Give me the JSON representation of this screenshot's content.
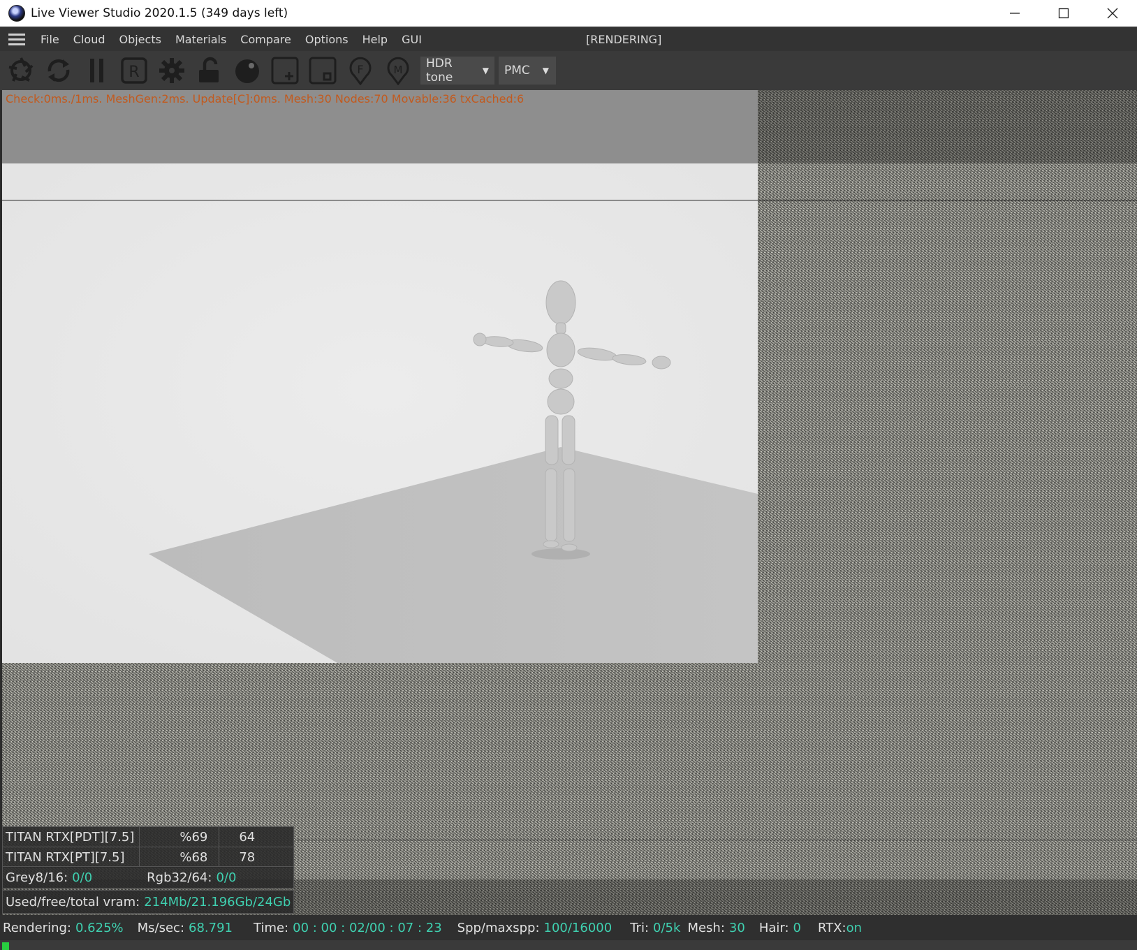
{
  "window": {
    "title": "Live Viewer Studio 2020.1.5 (349 days left)"
  },
  "menu": {
    "items": [
      "File",
      "Cloud",
      "Objects",
      "Materials",
      "Compare",
      "Options",
      "Help",
      "GUI"
    ],
    "status": "[RENDERING]"
  },
  "toolbar": {
    "buttons": [
      "aperture-icon",
      "refresh-icon",
      "pause-icon",
      "r-button-icon",
      "gear-icon",
      "unlock-icon",
      "sphere-icon",
      "add-region-icon",
      "region-icon",
      "f-pin-icon",
      "m-pin-icon"
    ],
    "r_label": "R",
    "f_label": "F",
    "m_label": "M",
    "tone_dropdown": "HDR tone",
    "kernel_dropdown": "PMC"
  },
  "viewport": {
    "info": "Check:0ms./1ms. MeshGen:2ms. Update[C]:0ms. Mesh:30 Nodes:70 Movable:36 txCached:6"
  },
  "gpus": [
    {
      "name": "TITAN RTX[PDT][7.5]",
      "pct": "%69",
      "value": "64"
    },
    {
      "name": "TITAN RTX[PT][7.5]",
      "pct": "%68",
      "value": "78"
    }
  ],
  "textures": {
    "grey_label": "Grey8/16:",
    "grey_value": "0/0",
    "rgb_label": "Rgb32/64:",
    "rgb_value": "0/0"
  },
  "vram": {
    "label": "Used/free/total vram:",
    "value": "214Mb/21.196Gb/24Gb"
  },
  "status": {
    "rendering_label": "Rendering:",
    "rendering_value": "0.625%",
    "ms_label": "Ms/sec:",
    "ms_value": "68.791",
    "time_label": "Time:",
    "time_value": "00 : 00 : 02/00 : 07 : 23",
    "spp_label": "Spp/maxspp:",
    "spp_value": "100/16000",
    "tri_label": "Tri:",
    "tri_value": "0/5k",
    "mesh_label": "Mesh:",
    "mesh_value": "30",
    "hair_label": "Hair:",
    "hair_value": "0",
    "rtx_label": "RTX:",
    "rtx_value": "on"
  },
  "progress": {
    "fraction": 0.00625
  },
  "colors": {
    "accent_green": "#3fd0b0",
    "info_orange": "#c25a1e",
    "progress_green": "#28d040"
  }
}
